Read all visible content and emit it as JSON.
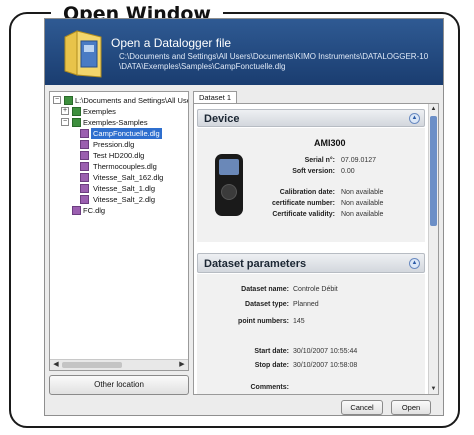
{
  "frame": {
    "title": "Open Window"
  },
  "header": {
    "title": "Open a Datalogger file",
    "path_line1": "C:\\Documents and Settings\\All Users\\Documents\\KIMO Instruments\\DATALOGGER-10",
    "path_line2": "\\DATA\\Exemples\\Samples\\CampFonctuelle.dlg"
  },
  "tree": {
    "root": "L:\\Documents and Settings\\All Users",
    "items": [
      {
        "label": "Exemples",
        "type": "folder"
      },
      {
        "label": "Exemples-Samples",
        "type": "folder"
      },
      {
        "label": "CampFonctuelle.dlg",
        "type": "file",
        "selected": true
      },
      {
        "label": "Pression.dlg",
        "type": "file"
      },
      {
        "label": "Test HD200.dlg",
        "type": "file"
      },
      {
        "label": "Thermocouples.dlg",
        "type": "file"
      },
      {
        "label": "Vitesse_Salt_162.dlg",
        "type": "file"
      },
      {
        "label": "Vitesse_Salt_1.dlg",
        "type": "file"
      },
      {
        "label": "Vitesse_Salt_2.dlg",
        "type": "file"
      },
      {
        "label": "FC.dlg",
        "type": "file"
      }
    ]
  },
  "buttons": {
    "other_location": "Other location",
    "cancel": "Cancel",
    "open": "Open"
  },
  "tabs": {
    "dataset1": "Dataset 1"
  },
  "device": {
    "section_title": "Device",
    "model": "AMI300",
    "rows": [
      {
        "label": "Serial n°:",
        "value": "07.09.0127"
      },
      {
        "label": "Soft version:",
        "value": "0.00"
      },
      {
        "label": "Calibration date:",
        "value": "Non available"
      },
      {
        "label": "certificate number:",
        "value": "Non available"
      },
      {
        "label": "Certificate validity:",
        "value": "Non available"
      }
    ]
  },
  "dataset": {
    "section_title": "Dataset parameters",
    "rows": [
      {
        "label": "Dataset name:",
        "value": "Controle Débit"
      },
      {
        "label": "Dataset type:",
        "value": "Planned"
      },
      {
        "label": "point numbers:",
        "value": "145"
      },
      {
        "label": "Start date:",
        "value": "30/10/2007 10:55:44"
      },
      {
        "label": "Stop date:",
        "value": "30/10/2007 10:58:08"
      },
      {
        "label": "Comments:",
        "value": ""
      }
    ]
  },
  "colors": {
    "header_bg": "#1a3d70",
    "selection": "#2f6fce",
    "section_hdr": "#d3d7dd"
  }
}
